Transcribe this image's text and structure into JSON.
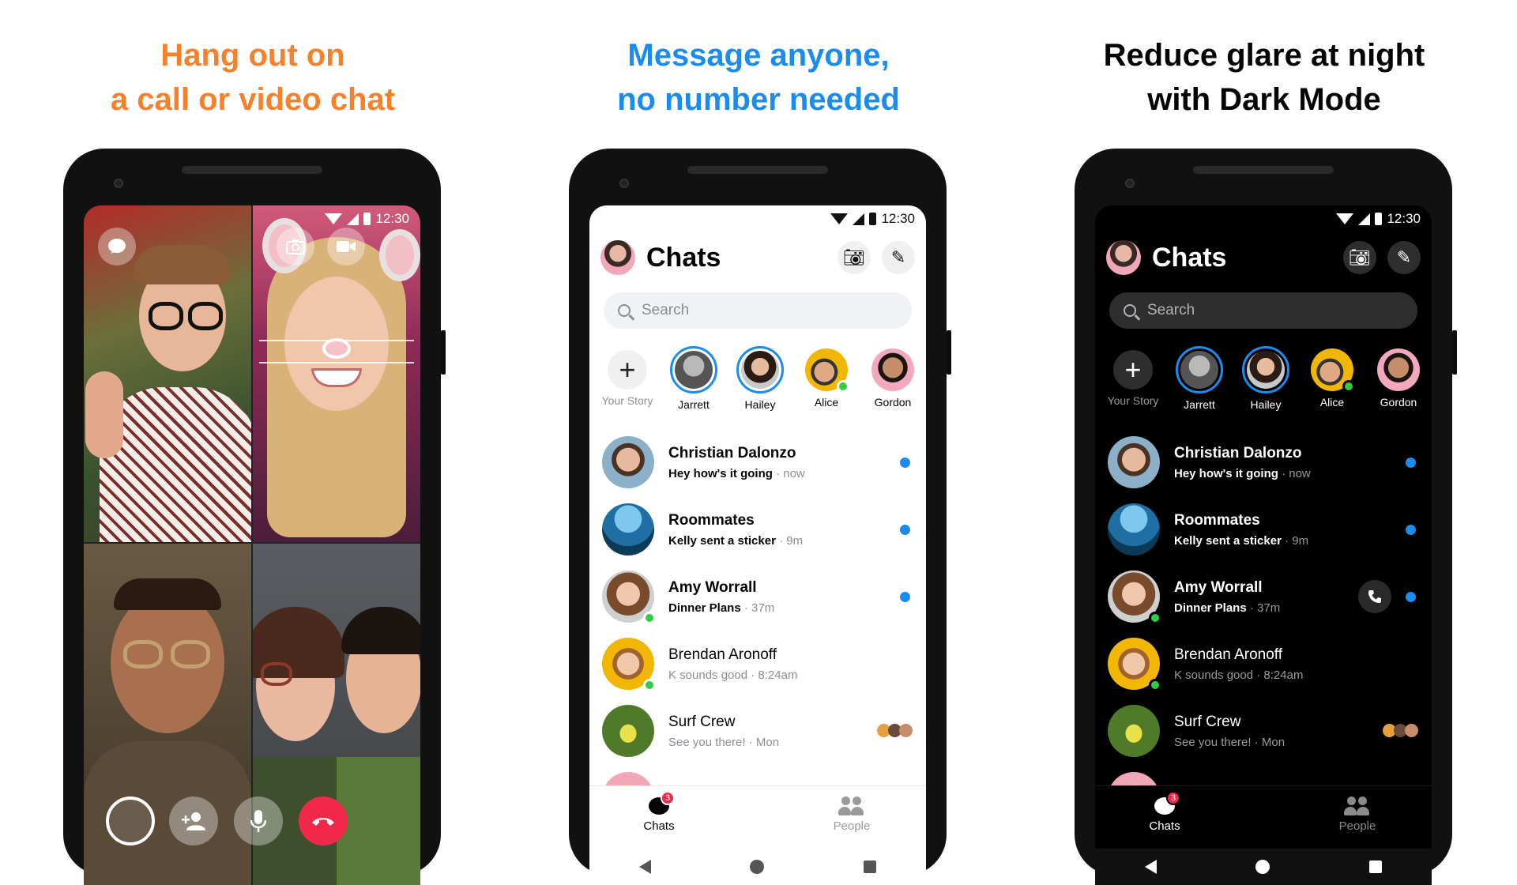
{
  "panels": [
    {
      "headline": [
        "Hang out on",
        "a call or video chat"
      ],
      "headline_color": "#f6812a",
      "status": {
        "time": "12:30"
      },
      "controls": [
        "chat-bubble-icon",
        "camera-flip-icon",
        "video-icon",
        "add-person-icon",
        "microphone-icon",
        "hang-up-icon"
      ],
      "colors": {
        "hangup": "#f02849"
      }
    },
    {
      "headline": [
        "Message anyone,",
        "no number needed"
      ],
      "headline_color": "#1a8cf0",
      "theme": "light"
    },
    {
      "headline": [
        "Reduce glare at night",
        "with Dark Mode"
      ],
      "headline_color": "#050505",
      "theme": "dark"
    }
  ],
  "chats": {
    "status_time": "12:30",
    "title": "Chats",
    "search_placeholder": "Search",
    "stories": [
      {
        "label": "Your Story",
        "add": true
      },
      {
        "label": "Jarrett",
        "ring": true
      },
      {
        "label": "Hailey",
        "ring": true
      },
      {
        "label": "Alice",
        "online": true
      },
      {
        "label": "Gordon"
      }
    ],
    "rows": [
      {
        "name": "Christian Dalonzo",
        "message": "Hey how's it going",
        "time": "now",
        "unread": true
      },
      {
        "name": "Roommates",
        "message": "Kelly sent a sticker",
        "time": "9m",
        "unread": true
      },
      {
        "name": "Amy Worrall",
        "message": "Dinner Plans",
        "time": "37m",
        "unread": true,
        "online": true
      },
      {
        "name": "Brendan Aronoff",
        "message": "K sounds good",
        "time": "8:24am",
        "online": true
      },
      {
        "name": "Surf Crew",
        "message": "See you there!",
        "time": "Mon"
      }
    ],
    "tabs": [
      {
        "label": "Chats",
        "badge": "3"
      },
      {
        "label": "People"
      }
    ],
    "colors": {
      "accent": "#1a8cf0",
      "online": "#31cc46",
      "badge": "#f02849"
    }
  }
}
